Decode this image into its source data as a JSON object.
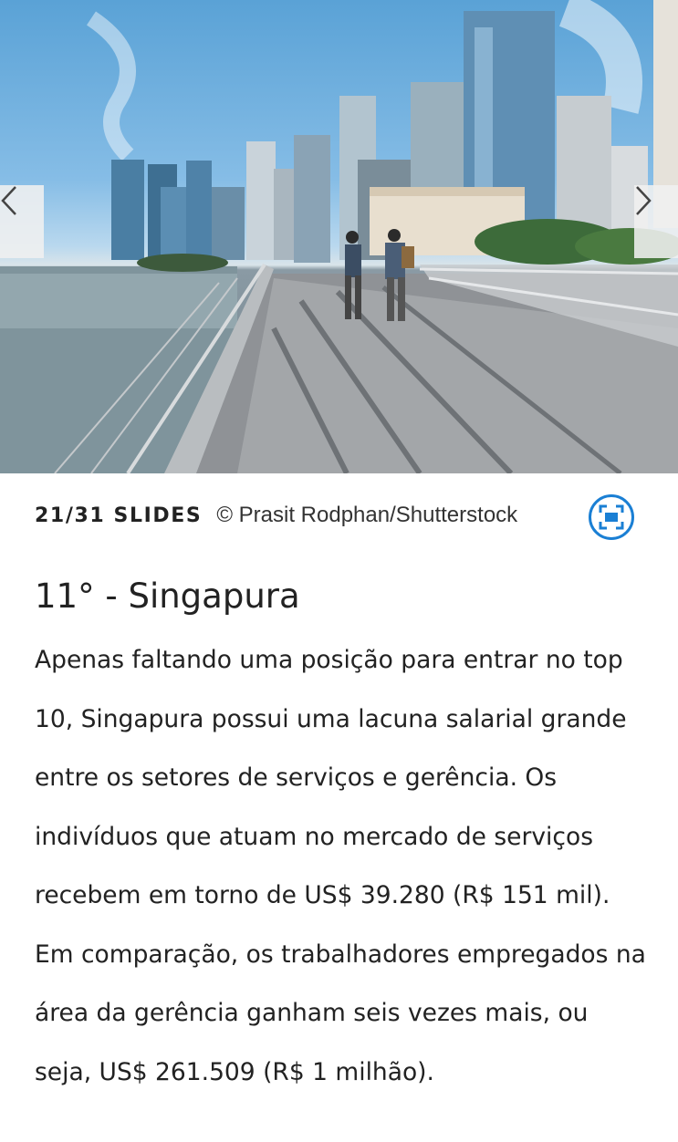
{
  "slide": {
    "counter": "21/31 SLIDES",
    "credit": "© Prasit Rodphan/Shutterstock"
  },
  "controls": {
    "prev_icon": "chevron-left-icon",
    "next_icon": "chevron-right-icon",
    "expand_icon": "fullscreen-icon"
  },
  "article": {
    "title": "11° - Singapura",
    "body": "Apenas faltando uma posição para entrar no top 10, Singapura possui uma lacuna salarial grande entre os setores de serviços e gerência. Os indivíduos que atuam no mercado de serviços recebem em torno de US$ 39.280 (R$ 151 mil). Em comparação, os trabalhadores empregados na área da gerência ganham seis vezes mais, ou seja, US$ 261.509 (R$ 1 milhão)."
  },
  "colors": {
    "accent": "#1a7fd4",
    "text": "#222222",
    "arrow_bg": "#f0f0f0"
  }
}
